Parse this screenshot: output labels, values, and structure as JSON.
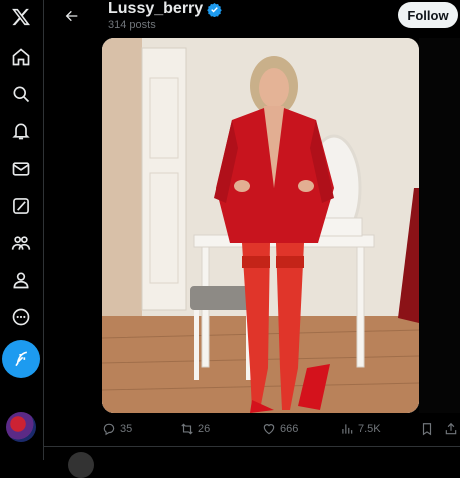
{
  "profile": {
    "name": "Lussy_berry",
    "post_count": "314 posts",
    "follow_label": "Follow"
  },
  "nav": {
    "items": [
      "x-logo-icon",
      "home-icon",
      "search-icon",
      "notifications-icon",
      "messages-icon",
      "grok-icon",
      "communities-icon",
      "profile-icon",
      "more-icon"
    ],
    "compose": "compose-icon"
  },
  "post_actions": {
    "replies": "35",
    "reposts": "26",
    "likes": "666",
    "views": "7.5K"
  },
  "colors": {
    "accent": "#1d9bf0",
    "background": "#000000",
    "text": "#e7e9ea",
    "muted": "#71767b",
    "outfit_red": "#c8141e"
  }
}
